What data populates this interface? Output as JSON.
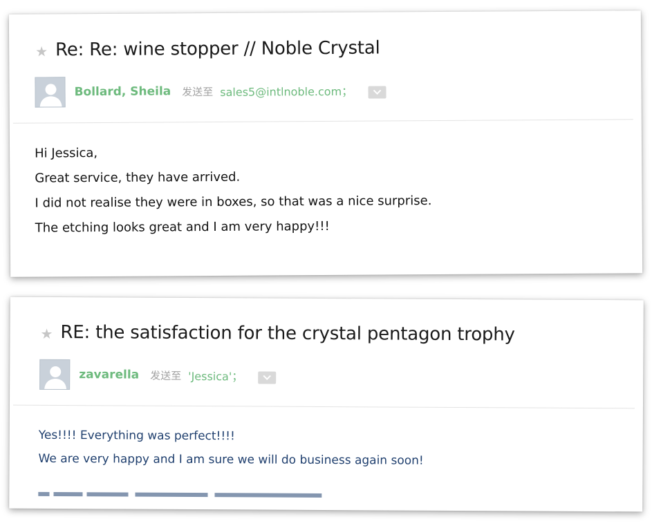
{
  "emails": [
    {
      "subject": "Re: Re: wine stopper // Noble Crystal",
      "sender": "Bollard, Sheila",
      "sent_to_label": "发送至",
      "recipient": "sales5@intlnoble.com；",
      "body_lines": [
        "Hi Jessica,",
        "Great service, they have arrived.",
        "I did not realise they were in boxes, so that was a nice surprise.",
        "The etching looks great and I am very happy!!!"
      ]
    },
    {
      "subject": "RE: the satisfaction for the crystal pentagon trophy",
      "sender": "zavarella",
      "sent_to_label": "发送至",
      "recipient": "'Jessica'；",
      "body_lines": [
        "Yes!!!!  Everything was perfect!!!!",
        "We are very happy and I am sure we will do business again soon!"
      ]
    }
  ],
  "icons": {
    "star": "star-icon",
    "avatar": "default-avatar-icon",
    "dropdown": "chevron-down-icon"
  },
  "colors": {
    "sender_green": "#6dba7d",
    "body_blue": "#1f3f6e",
    "star_gray": "#c6c6c6"
  }
}
